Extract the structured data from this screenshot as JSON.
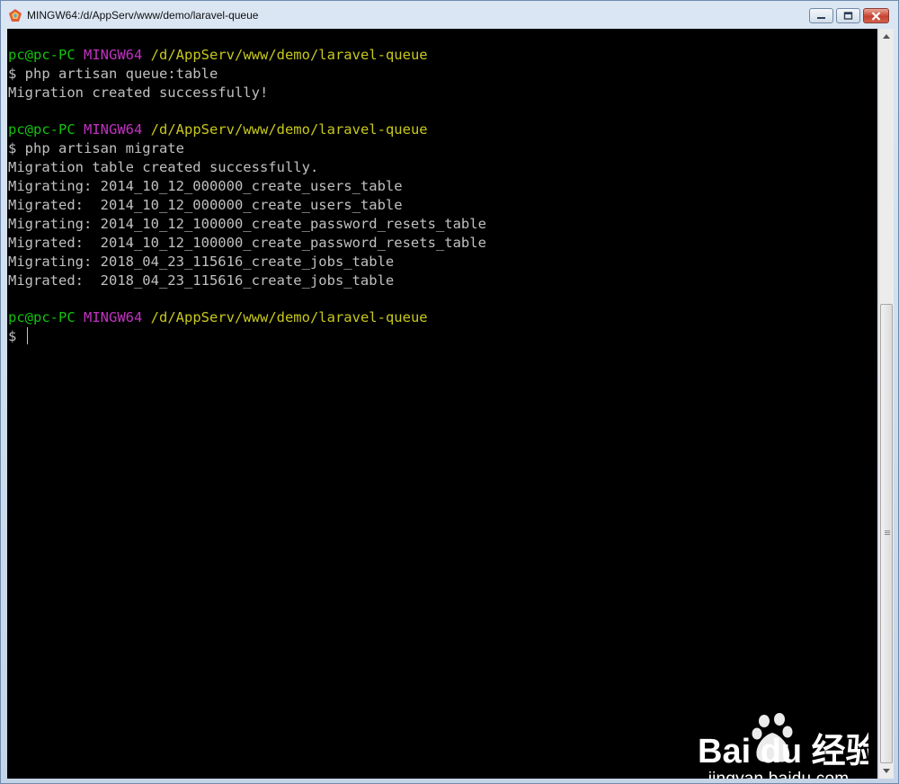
{
  "window": {
    "title": "MINGW64:/d/AppServ/www/demo/laravel-queue",
    "controls": {
      "minimize": "minimize",
      "maximize": "maximize",
      "close": "close"
    }
  },
  "colors": {
    "background": "#000000",
    "text": "#c0c0c0",
    "user_host": "#13c10e",
    "system": "#c231c2",
    "path": "#c8c81c"
  },
  "terminal": {
    "prompts": [
      {
        "user": "pc@pc-PC",
        "system": "MINGW64",
        "path": "/d/AppServ/www/demo/laravel-queue"
      },
      {
        "user": "pc@pc-PC",
        "system": "MINGW64",
        "path": "/d/AppServ/www/demo/laravel-queue"
      },
      {
        "user": "pc@pc-PC",
        "system": "MINGW64",
        "path": "/d/AppServ/www/demo/laravel-queue"
      }
    ],
    "commands": [
      "$ php artisan queue:table",
      "$ php artisan migrate",
      "$ "
    ],
    "outputs": [
      "Migration created successfully!",
      "Migration table created successfully.",
      "Migrating: 2014_10_12_000000_create_users_table",
      "Migrated:  2014_10_12_000000_create_users_table",
      "Migrating: 2014_10_12_100000_create_password_resets_table",
      "Migrated:  2014_10_12_100000_create_password_resets_table",
      "Migrating: 2018_04_23_115616_create_jobs_table",
      "Migrated:  2018_04_23_115616_create_jobs_table"
    ]
  },
  "scrollbar": {
    "scroll_position": 0.37
  },
  "watermark": {
    "logo_text": "Bai du 经验",
    "url": "jingyan.baidu.com"
  }
}
